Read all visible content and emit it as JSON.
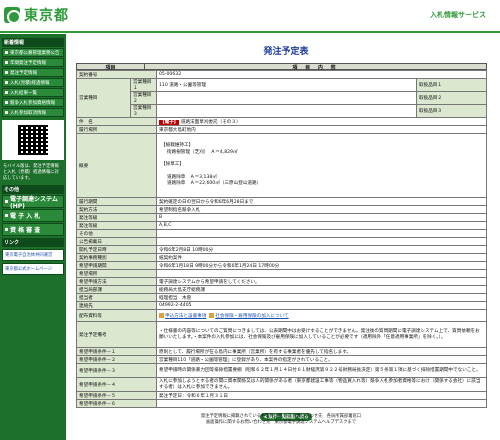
{
  "header": {
    "logo_text": "東京都",
    "service_title": "入札情報サービス"
  },
  "sidebar": {
    "section_news": "新着情報",
    "news_items": [
      "東京都公募管理業務公告",
      "年間発注予定情報",
      "発注予定情報",
      "入札(見積)経過情報",
      "入札結果一覧",
      "競争入札参加資格情報",
      "入札参加取消情報"
    ],
    "mobile_text": "モバイル版は、発注予定情報と入札（見積）経過情報に対応しています。",
    "section_other": "その他",
    "big_items": [
      "電子調達システム(HP)",
      "電 子 入 札",
      "資 格 審 査"
    ],
    "section_links": "リンク",
    "links": [
      "東京電子自治体共同運営",
      "東京都公式ホームページ"
    ]
  },
  "page": {
    "title": "発注予定表",
    "header_item": "項目",
    "header_content": "項 目 内 容",
    "back_button": "◀ 案件一覧画面へ戻る",
    "footer_line1": "発注予定情報に掲載されている各案件に関する お問い合わせ先　各局所属部署窓口",
    "footer_line2": "画面操作に関するお問い合わせ先　東京都電子調達システムヘルプデスクまで"
  },
  "rows": {
    "contract_no": {
      "label": "契約番号",
      "value": "05-00632"
    },
    "biz_cat1": {
      "label": "営業種目",
      "sub": "営業種目１",
      "value": "110 道路・公園等管理",
      "tag": "取扱品目１"
    },
    "biz_cat2": {
      "sub": "営業種目２",
      "tag": "取扱品目２"
    },
    "biz_cat3": {
      "sub": "営業種目３",
      "tag": "取扱品目３"
    },
    "name": {
      "label": "件　名",
      "badge": "【電子】",
      "value": "道路法面草刈委託（その３）"
    },
    "place": {
      "label": "履行場所",
      "value": "東京都大島町地内"
    },
    "summary": {
      "label": "概要",
      "l1": "【植栽維持工】",
      "l2": "街路樹管理（芝刈）　Ａ＝4,829㎡",
      "l3": "【除草工】",
      "l4": "道路除草　Ａ＝3,138㎡",
      "l5": "道路除草　Ａ＝22,600㎡（三原山登山道路）"
    },
    "period": {
      "label": "履行期間",
      "value": "契約確定の日の翌日から令和6年6月28日まで"
    },
    "method": {
      "label": "契約方法",
      "value": "希望制指名競争入札"
    },
    "grade": {
      "label": "発注等級",
      "value": "B"
    },
    "bid_grade": {
      "label": "発注等級",
      "value": "A,B,C"
    },
    "other": {
      "label": "その他"
    },
    "pub_date": {
      "label": "公告掲載日"
    },
    "open_date": {
      "label": "開札予定日時",
      "value": "令和6年2月8日 10時00分"
    },
    "bid_method": {
      "label": "契約事務種別",
      "value": "紙契約案件"
    },
    "apply_period": {
      "label": "希望申請期間",
      "value": "令和6年1月18日 9時00分から令和6年1月24日 17時00分"
    },
    "apply_place": {
      "label": "希望場所"
    },
    "apply_method": {
      "label": "希望申請方法",
      "value": "電子調達システムから希望申請をしてください。"
    },
    "dept": {
      "label": "担当局部課",
      "value": "総務局大島支庁総務課"
    },
    "person": {
      "label": "担当者",
      "value": "経理担当　木曽"
    },
    "tel": {
      "label": "連絡先",
      "value": "04992-2-4405"
    },
    "docs": {
      "label": "配布資料等",
      "link1": "申込方法と設書事項",
      "link2": "社会保険・雇用保険の加入について"
    },
    "notes": {
      "label": "発注予定備考",
      "value": "・仕様書の内容等についてのご質問につきましては、公表期間中はお受けすることができません。発注後の質問期間に電子調達システム上で、質問依頼をお願いいたします。・本案件の入札参加には、社会保険及び雇用保険に加入していることが必要です（適用除外「任意適用事業所」を除く。）。"
    },
    "cond1": {
      "label": "希望申請条件－１",
      "value": "原則として、履行場所が在る島内に事業所（営業所）を有する事業者を優先して指名します。"
    },
    "cond2": {
      "label": "希望申請条件－２",
      "value": "営業種目110「道路・公園等管理」に登録があり、本案件の指定がされていること。"
    },
    "cond3": {
      "label": "希望申請条件－３",
      "value": "希望申請時の関係暴力団等排除措置要綱（昭和６２年１月１４日付６１財経庶第９２２号財務局長決定）第５条第１項に基づく排除措置期間中でないこと。"
    },
    "cond4": {
      "label": "希望申請条件－４",
      "value": "入札に参加しようとする者の間に資本関係又は人的関係がある者（東京都建設工事等（物品買入れ等）競争入札参加者資格等におけ（関係する会社）に該当する者）は入札に参加できません。"
    },
    "cond5": {
      "label": "希望申請条件－５",
      "value": "発注予定日：令和６年１月３１日"
    },
    "cond6": {
      "label": "希望申請条件－６"
    }
  }
}
